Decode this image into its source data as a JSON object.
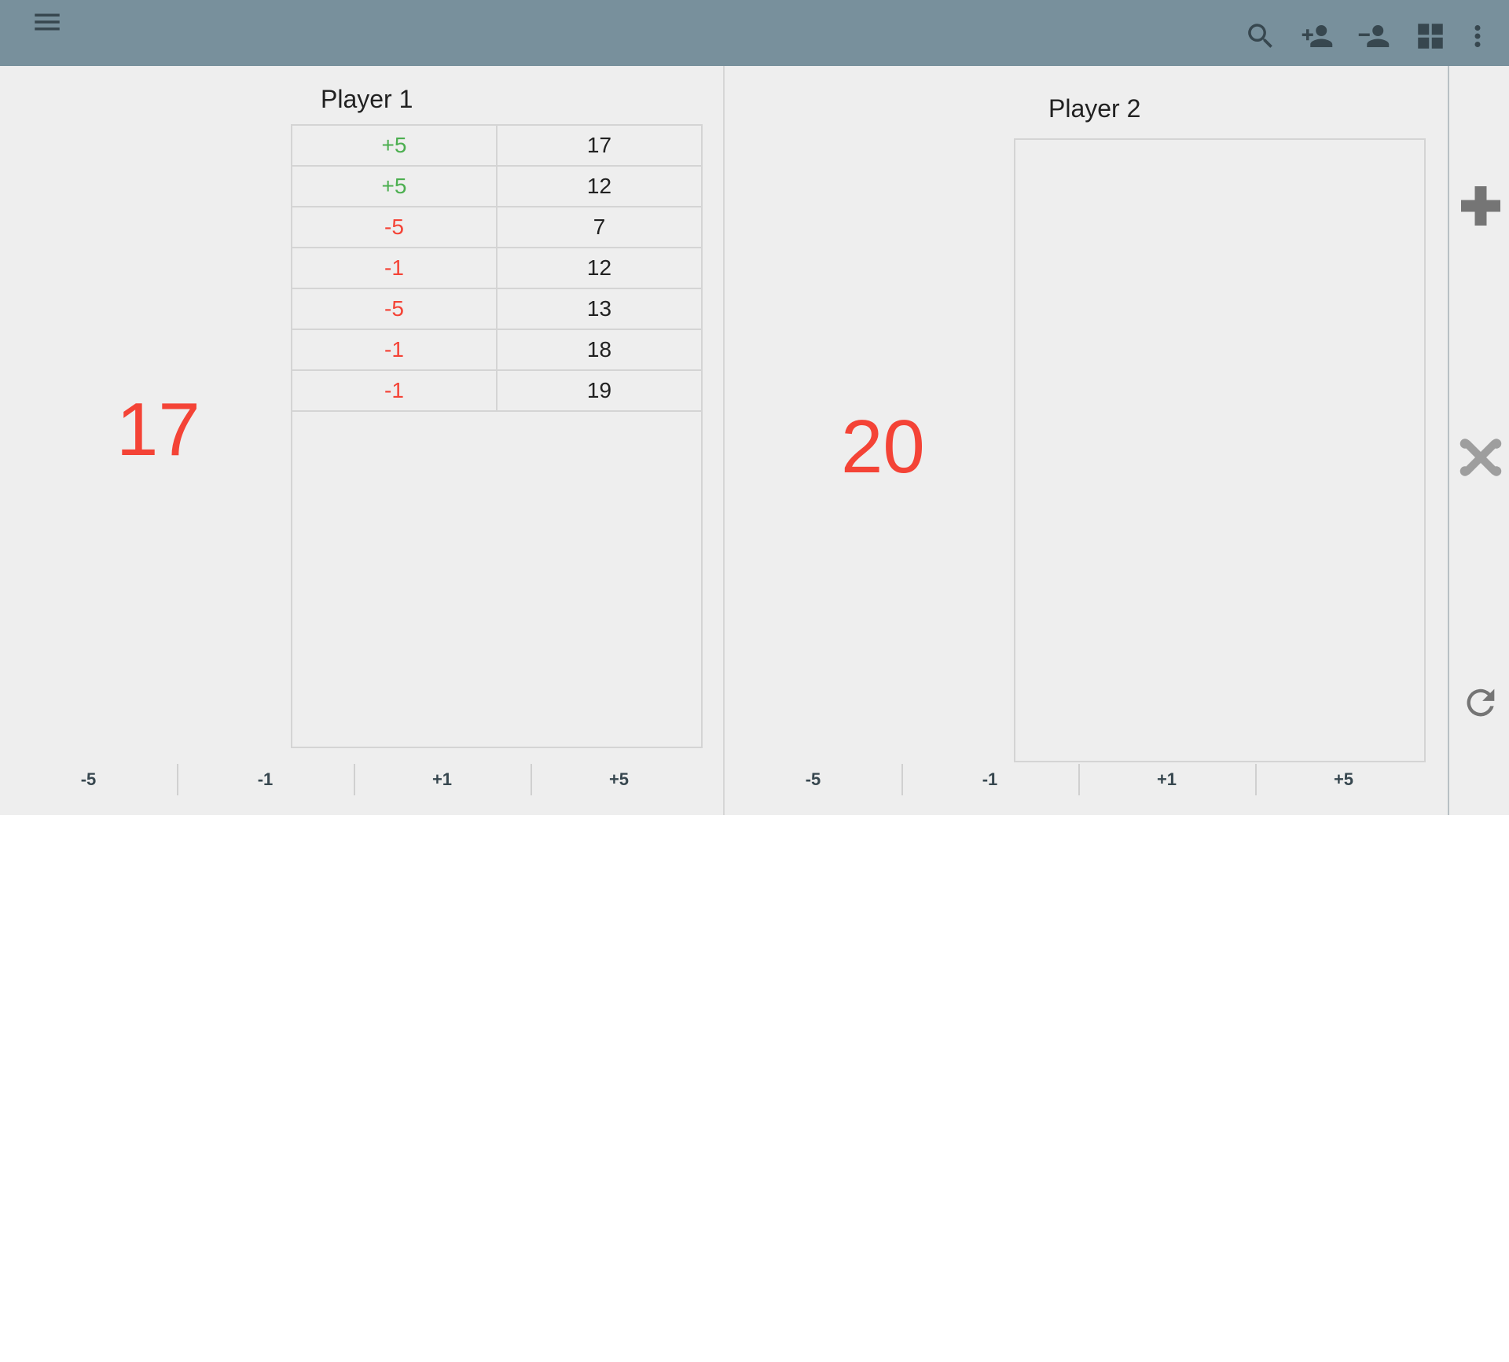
{
  "toolbar": {
    "icons": [
      "menu-icon",
      "search-icon",
      "add-player-icon",
      "remove-player-icon",
      "grid-layout-icon",
      "more-vert-icon"
    ],
    "colors": {
      "appbar": "#78909c",
      "icon": "#37474f"
    }
  },
  "players": [
    {
      "name": "Player 1",
      "life": "17",
      "history": [
        {
          "delta": "+5",
          "total": "17",
          "sign": "positive"
        },
        {
          "delta": "+5",
          "total": "12",
          "sign": "positive"
        },
        {
          "delta": "-5",
          "total": "7",
          "sign": "negative"
        },
        {
          "delta": "-1",
          "total": "12",
          "sign": "negative"
        },
        {
          "delta": "-5",
          "total": "13",
          "sign": "negative"
        },
        {
          "delta": "-1",
          "total": "18",
          "sign": "negative"
        },
        {
          "delta": "-1",
          "total": "19",
          "sign": "negative"
        }
      ],
      "buttons": [
        "-5",
        "-1",
        "+1",
        "+5"
      ]
    },
    {
      "name": "Player 2",
      "life": "20",
      "history": [],
      "buttons": [
        "-5",
        "-1",
        "+1",
        "+5"
      ]
    }
  ],
  "side_rail": {
    "icons": [
      "add-icon",
      "dice-icon",
      "reset-icon"
    ]
  },
  "colors": {
    "life": "#f44336",
    "positive": "#4caf50",
    "negative": "#f44336"
  }
}
